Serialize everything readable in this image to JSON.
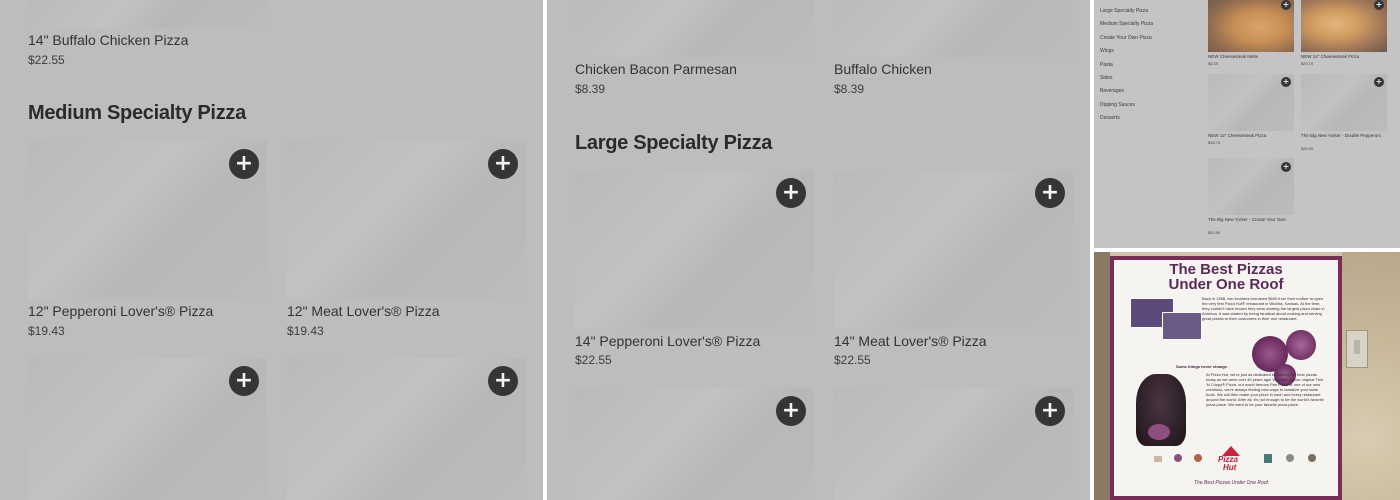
{
  "panel_a": {
    "top_item": {
      "name": "14\" Buffalo Chicken Pizza",
      "price": "$22.55"
    },
    "section_title": "Medium Specialty Pizza",
    "items": [
      {
        "name": "12\" Pepperoni Lover's® Pizza",
        "price": "$19.43"
      },
      {
        "name": "12\" Meat Lover's® Pizza",
        "price": "$19.43"
      }
    ],
    "add_glyph": "+"
  },
  "panel_b": {
    "top_items": [
      {
        "name": "Chicken Bacon Parmesan",
        "price": "$8.39"
      },
      {
        "name": "Buffalo Chicken",
        "price": "$8.39"
      }
    ],
    "section_title": "Large Specialty Pizza",
    "items": [
      {
        "name": "14\" Pepperoni Lover's® Pizza",
        "price": "$22.55"
      },
      {
        "name": "14\" Meat Lover's® Pizza",
        "price": "$22.55"
      }
    ],
    "add_glyph": "+"
  },
  "panel_c": {
    "categories": [
      "Large Specialty Pizza",
      "Medium Specialty Pizza",
      "Create Your Own Pizza",
      "Wings",
      "Pasta",
      "Sides",
      "Beverages",
      "Dipping Sauces",
      "Desserts"
    ],
    "items": [
      {
        "name": "NEW Cheesesteak Melts",
        "price": "$8.39"
      },
      {
        "name": "NEW 14\" Cheesesteak Pizza",
        "price": "$20.19"
      },
      {
        "name": "NEW 12\" Cheesesteak Pizza",
        "price": "$16.79"
      },
      {
        "name": "The Big New Yorker - Double Pepperoni",
        "price": "$20.59"
      },
      {
        "name": "The Big New Yorker - Create Your Own",
        "price": "$20.59"
      }
    ],
    "add_glyph": "+"
  },
  "panel_d": {
    "title_line1": "The Best Pizzas",
    "title_line2": "Under One Roof",
    "subheading": "Some things never change.",
    "body_1": "Back in 1958, two brothers borrowed $600 from their mother to open the very first Pizza Hut® restaurant in Wichita, Kansas. At the time, they couldn't have known they were starting the largest pizza chain in America. It was started by being fanatical about making and serving great pizzas to their customers in their one restaurant.",
    "body_2": "At Pizza Hut, we're just as dedicated to making the best pizzas today as we were over 40 years ago! Whether it's our original Thin 'N Crispy® Pizza, our world famous Pan Pizza or one of our new creations, we're always finding new ways to tantalize your taste buds. We will then make your pizza in each and every restaurant around the world. After all, it's not enough to be the world's favorite pizza place. We want to be your favorite pizza place.",
    "logo_line1": "Pizza",
    "logo_line2": "Hut",
    "footer": "The Best Pizzas Under One Roof."
  }
}
